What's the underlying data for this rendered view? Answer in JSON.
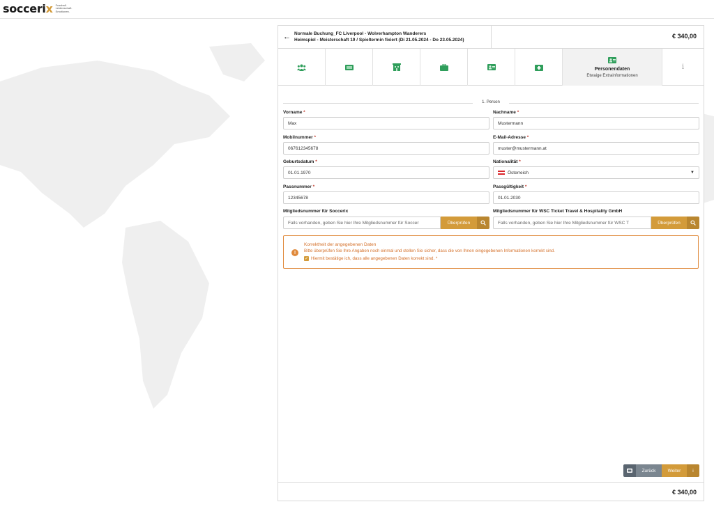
{
  "brand": {
    "name_main": "socceri",
    "name_accent": "x",
    "tagline": [
      "Fussball.",
      "Leidenschaft.",
      "Emotionen."
    ],
    "accent_color": "#d39b3a"
  },
  "header": {
    "back_icon": "arrow-left-icon",
    "line1": "Normale Buchung_FC Liverpool - Wolverhampton Wanderers",
    "line2": "Heimspiel - Meisterschaft 19 / Spieltermin fixiert (Di 21.05.2024 - Do 23.05.2024)",
    "price": "€ 340,00"
  },
  "steps": [
    {
      "icon": "group-icon"
    },
    {
      "icon": "ticket-icon"
    },
    {
      "icon": "hotel-icon"
    },
    {
      "icon": "luggage-icon"
    },
    {
      "icon": "id-card-icon"
    },
    {
      "icon": "medical-kit-icon"
    },
    {
      "icon": "id-card-active-icon",
      "title": "Personendaten",
      "subtitle": "Etwaige Extrainformationen",
      "active": true
    },
    {
      "icon": "info-icon",
      "glyph": "i"
    }
  ],
  "form": {
    "section_title": "1. Person",
    "first_name": {
      "label": "Vorname",
      "value": "Max"
    },
    "last_name": {
      "label": "Nachname",
      "value": "Mustermann"
    },
    "mobile": {
      "label": "Mobilnummer",
      "value": "067612345678"
    },
    "email": {
      "label": "E-Mail-Adresse",
      "value": "muster@mustermann.at"
    },
    "birthdate": {
      "label": "Geburtsdatum",
      "value": "01.01.1970"
    },
    "nationality": {
      "label": "Nationalität",
      "value": "Österreich"
    },
    "passport": {
      "label": "Passnummer",
      "value": "12345678"
    },
    "passport_valid": {
      "label": "Passgültigkeit",
      "value": "01.01.2030"
    },
    "member_soccerix": {
      "label": "Mitgliedsnummer für Soccerix",
      "placeholder": "Falls vorhanden, geben Sie hier Ihre Mitgliedsnummer für Soccer",
      "button": "Überprüfen"
    },
    "member_wsc": {
      "label": "Mitgliedsnummer für WSC Ticket Travel & Hospitality GmbH",
      "placeholder": "Falls vorhanden, geben Sie hier Ihre Mitgliedsnummer für WSC T",
      "button": "Überprüfen"
    },
    "required_marker": "*"
  },
  "notice": {
    "icon_glyph": "!",
    "title": "Korrektheit der angegebenen Daten",
    "text": "Bitte überprüfen Sie Ihre Angaben noch einmal und stellen Sie sicher, dass die von Ihnen eingegebenen Informationen korrekt sind.",
    "checkbox_label": "Hiermit bestätige ich, dass alle angegebenen Daten korrekt sind.",
    "checked": true
  },
  "actions": {
    "back": "Zurück",
    "next": "Weiter",
    "info_glyph": "i"
  },
  "footer": {
    "price": "€ 340,00"
  },
  "colors": {
    "accent": "#d39b3a",
    "accent_dark": "#b9862f",
    "warning": "#e08a3c",
    "step_icon_green": "#2f9e5b"
  }
}
